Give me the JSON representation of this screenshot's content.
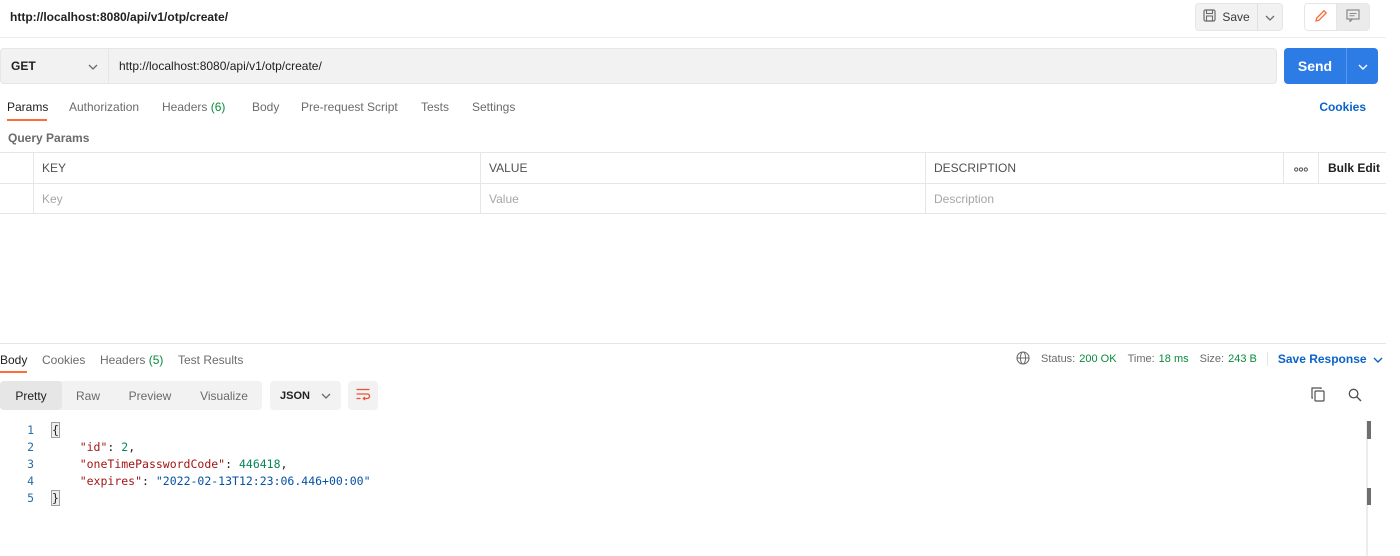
{
  "titlebar": {
    "title": "http://localhost:8080/api/v1/otp/create/",
    "save_label": "Save"
  },
  "request": {
    "method": "GET",
    "url": "http://localhost:8080/api/v1/otp/create/",
    "send_label": "Send"
  },
  "request_tabs": {
    "params": "Params",
    "authorization": "Authorization",
    "headers": "Headers",
    "headers_count": "(6)",
    "body": "Body",
    "prerequest": "Pre-request Script",
    "tests": "Tests",
    "settings": "Settings",
    "cookies": "Cookies"
  },
  "query_params": {
    "label": "Query Params",
    "headers": {
      "key": "KEY",
      "value": "VALUE",
      "description": "DESCRIPTION",
      "more": "ooo",
      "bulk_edit": "Bulk Edit"
    },
    "placeholders": {
      "key": "Key",
      "value": "Value",
      "description": "Description"
    }
  },
  "response_tabs": {
    "body": "Body",
    "cookies": "Cookies",
    "headers": "Headers",
    "headers_count": "(5)",
    "test_results": "Test Results"
  },
  "response_meta": {
    "status_label": "Status:",
    "status_value": "200 OK",
    "time_label": "Time:",
    "time_value": "18 ms",
    "size_label": "Size:",
    "size_value": "243 B",
    "save_response": "Save Response"
  },
  "viewer": {
    "modes": [
      "Pretty",
      "Raw",
      "Preview",
      "Visualize"
    ],
    "active_mode": "Pretty",
    "format": "JSON"
  },
  "code_lines": {
    "line_numbers": [
      "1",
      "2",
      "3",
      "4",
      "5"
    ],
    "open_brace": "{",
    "close_brace": "}",
    "id_key": "\"id\"",
    "id_value": "2",
    "otp_key": "\"oneTimePasswordCode\"",
    "otp_value": "446418",
    "expires_key": "\"expires\"",
    "expires_value": "\"2022-02-13T12:23:06.446+00:00\""
  },
  "colors": {
    "accent_orange": "#ff6c37",
    "send_blue": "#2d7be5",
    "link_blue": "#0a63c9",
    "status_green": "#0a8a3c"
  },
  "icons": [
    "save-icon",
    "chevron-down-icon",
    "pencil-icon",
    "comment-icon",
    "globe-icon",
    "wrap-lines-icon",
    "copy-icon",
    "search-icon"
  ]
}
